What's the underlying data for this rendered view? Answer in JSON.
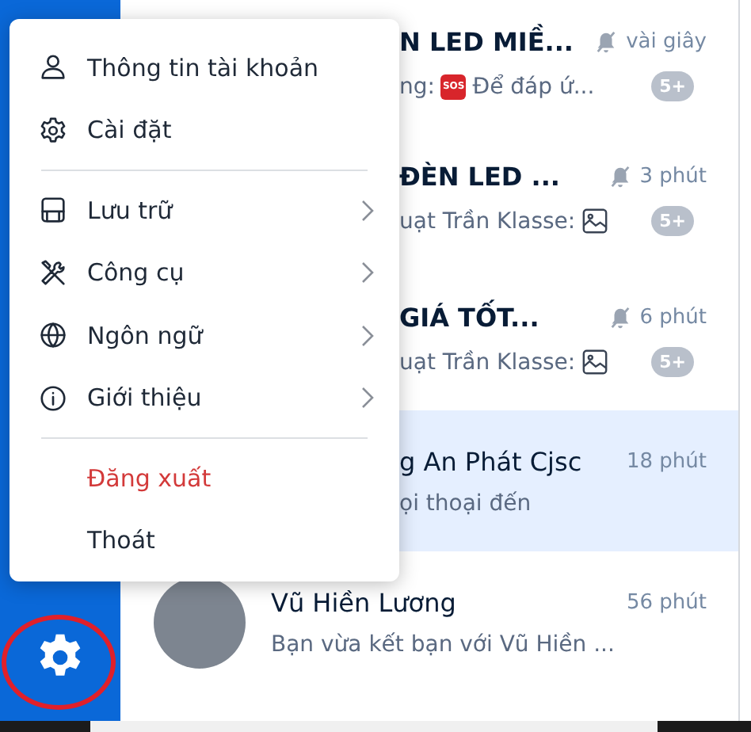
{
  "menu": {
    "items": [
      {
        "kind": "item",
        "label": "Thông tin tài khoản",
        "submenu": false
      },
      {
        "kind": "item",
        "label": "Cài đặt",
        "submenu": false
      },
      {
        "kind": "divider"
      },
      {
        "kind": "item",
        "label": "Lưu trữ",
        "submenu": true
      },
      {
        "kind": "item",
        "label": "Công cụ",
        "submenu": true
      },
      {
        "kind": "item",
        "label": "Ngôn ngữ",
        "submenu": true
      },
      {
        "kind": "item",
        "label": "Giới thiệu",
        "submenu": true
      },
      {
        "kind": "divider"
      },
      {
        "kind": "danger",
        "label": "Đăng xuất"
      },
      {
        "kind": "plain",
        "label": "Thoát"
      }
    ]
  },
  "conversations": [
    {
      "kind": "partial",
      "name": "N LED MIỀ...",
      "bold": true,
      "muted": true,
      "time": "vài giây",
      "badge": "5+",
      "selected": false,
      "preview": [
        {
          "kind": "text",
          "text": "ng:"
        },
        {
          "kind": "sos",
          "text": "SOS"
        },
        {
          "kind": "text",
          "text": "Để đáp ứ..."
        }
      ]
    },
    {
      "kind": "partial",
      "name": "ĐÈN LED ...",
      "bold": true,
      "muted": true,
      "time": "3 phút",
      "badge": "5+",
      "selected": false,
      "preview": [
        {
          "kind": "text",
          "text": "uạt Trần Klasse:"
        },
        {
          "kind": "image"
        }
      ]
    },
    {
      "kind": "partial",
      "name": "GIÁ TỐT...",
      "bold": true,
      "muted": true,
      "time": "6 phút",
      "badge": "5+",
      "selected": false,
      "preview": [
        {
          "kind": "text",
          "text": "uạt Trần Klasse:"
        },
        {
          "kind": "image"
        }
      ]
    },
    {
      "kind": "partial",
      "name": "g An Phát Cjsc",
      "bold": false,
      "muted": false,
      "time": "18 phút",
      "selected": true,
      "preview": [
        {
          "kind": "text",
          "text": "ọi thoại đến"
        }
      ]
    },
    {
      "kind": "full",
      "name": "Vũ Hiền Lương",
      "bold": false,
      "muted": false,
      "time": "56 phút",
      "selected": false,
      "preview": [
        {
          "kind": "text",
          "text": "Bạn vừa kết bạn với Vũ Hiền ..."
        }
      ]
    }
  ]
}
